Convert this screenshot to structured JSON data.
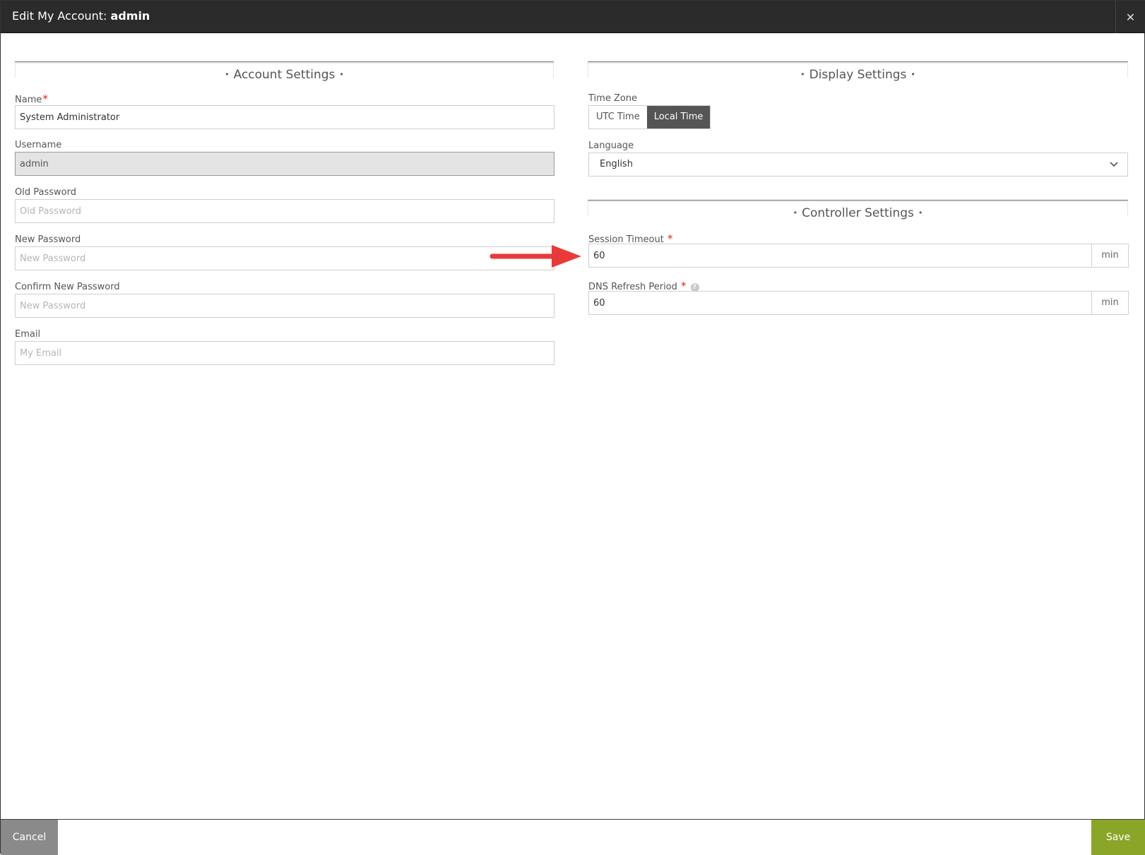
{
  "window": {
    "title_prefix": "Edit My Account: ",
    "title_user": "admin",
    "close_glyph": "✕"
  },
  "account": {
    "heading": "Account Settings",
    "name_label": "Name",
    "name_value": "System Administrator",
    "username_label": "Username",
    "username_value": "admin",
    "old_password_label": "Old Password",
    "old_password_placeholder": "Old Password",
    "new_password_label": "New Password",
    "new_password_placeholder": "New Password",
    "confirm_password_label": "Confirm New Password",
    "confirm_password_placeholder": "New Password",
    "email_label": "Email",
    "email_placeholder": "My Email"
  },
  "display": {
    "heading": "Display Settings",
    "timezone_label": "Time Zone",
    "timezone_options": [
      "UTC Time",
      "Local Time"
    ],
    "timezone_selected": "Local Time",
    "language_label": "Language",
    "language_value": "English"
  },
  "controller": {
    "heading": "Controller Settings",
    "session_timeout_label": "Session Timeout",
    "session_timeout_value": "60",
    "session_timeout_unit": "min",
    "dns_refresh_label": "DNS Refresh Period",
    "dns_refresh_value": "60",
    "dns_refresh_unit": "min"
  },
  "footer": {
    "cancel_label": "Cancel",
    "save_label": "Save"
  },
  "common": {
    "required_mark": "*",
    "help_glyph": "?",
    "chevron_glyph": "⌄",
    "dot": "•"
  },
  "colors": {
    "titlebar": "#2b2b2b",
    "save_button": "#8aa528",
    "cancel_button": "#8a8a8a",
    "required": "#e02020",
    "toggle_active": "#555555",
    "annotation_arrow": "#e83a3a"
  }
}
